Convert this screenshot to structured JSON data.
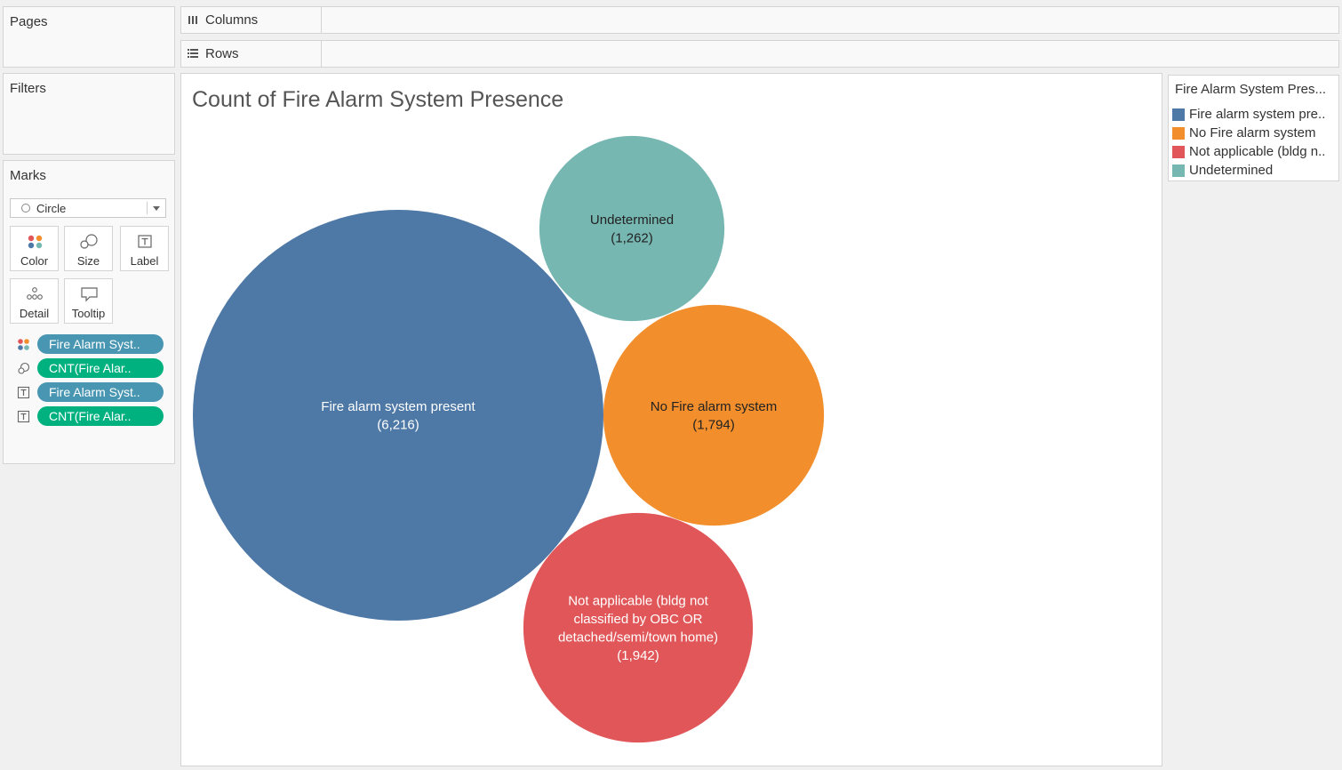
{
  "sidebar": {
    "pages_title": "Pages",
    "filters_title": "Filters",
    "marks_title": "Marks",
    "mark_type": "Circle",
    "mark_buttons": {
      "color": "Color",
      "size": "Size",
      "label": "Label",
      "detail": "Detail",
      "tooltip": "Tooltip"
    },
    "pills": [
      {
        "icon": "color-icon",
        "text": "Fire Alarm Syst..",
        "kind": "dimension"
      },
      {
        "icon": "size-icon",
        "text": "CNT(Fire Alar..",
        "kind": "measure"
      },
      {
        "icon": "label-icon",
        "text": "Fire Alarm Syst..",
        "kind": "dimension"
      },
      {
        "icon": "label-icon",
        "text": "CNT(Fire Alar..",
        "kind": "measure"
      }
    ]
  },
  "shelves": {
    "columns": "Columns",
    "rows": "Rows"
  },
  "legend": {
    "title": "Fire Alarm System Pres...",
    "items": [
      {
        "label": "Fire alarm system pre..",
        "color": "#4e79a7"
      },
      {
        "label": "No Fire alarm system",
        "color": "#f28e2b"
      },
      {
        "label": "Not applicable (bldg n..",
        "color": "#e15759"
      },
      {
        "label": "Undetermined",
        "color": "#76b7b2"
      }
    ]
  },
  "chart_data": {
    "type": "packed-bubble",
    "title": "Count of Fire Alarm System Presence",
    "series": [
      {
        "name": "Fire alarm system present",
        "value": 6216,
        "value_label": "(6,216)",
        "color": "#4e79a7",
        "label_lines": [
          "Fire alarm system present"
        ],
        "text_color": "#ffffff"
      },
      {
        "name": "Undetermined",
        "value": 1262,
        "value_label": "(1,262)",
        "color": "#76b7b2",
        "label_lines": [
          "Undetermined"
        ],
        "text_color": "#222222"
      },
      {
        "name": "No Fire alarm system",
        "value": 1794,
        "value_label": "(1,794)",
        "color": "#f28e2b",
        "label_lines": [
          "No Fire alarm system"
        ],
        "text_color": "#222222"
      },
      {
        "name": "Not applicable (bldg not classified by OBC OR detached/semi/town home)",
        "value": 1942,
        "value_label": "(1,942)",
        "color": "#e15759",
        "label_lines": [
          "Not applicable (bldg not",
          "classified by OBC OR",
          "detached/semi/town home)"
        ],
        "text_color": "#ffffff"
      }
    ]
  }
}
